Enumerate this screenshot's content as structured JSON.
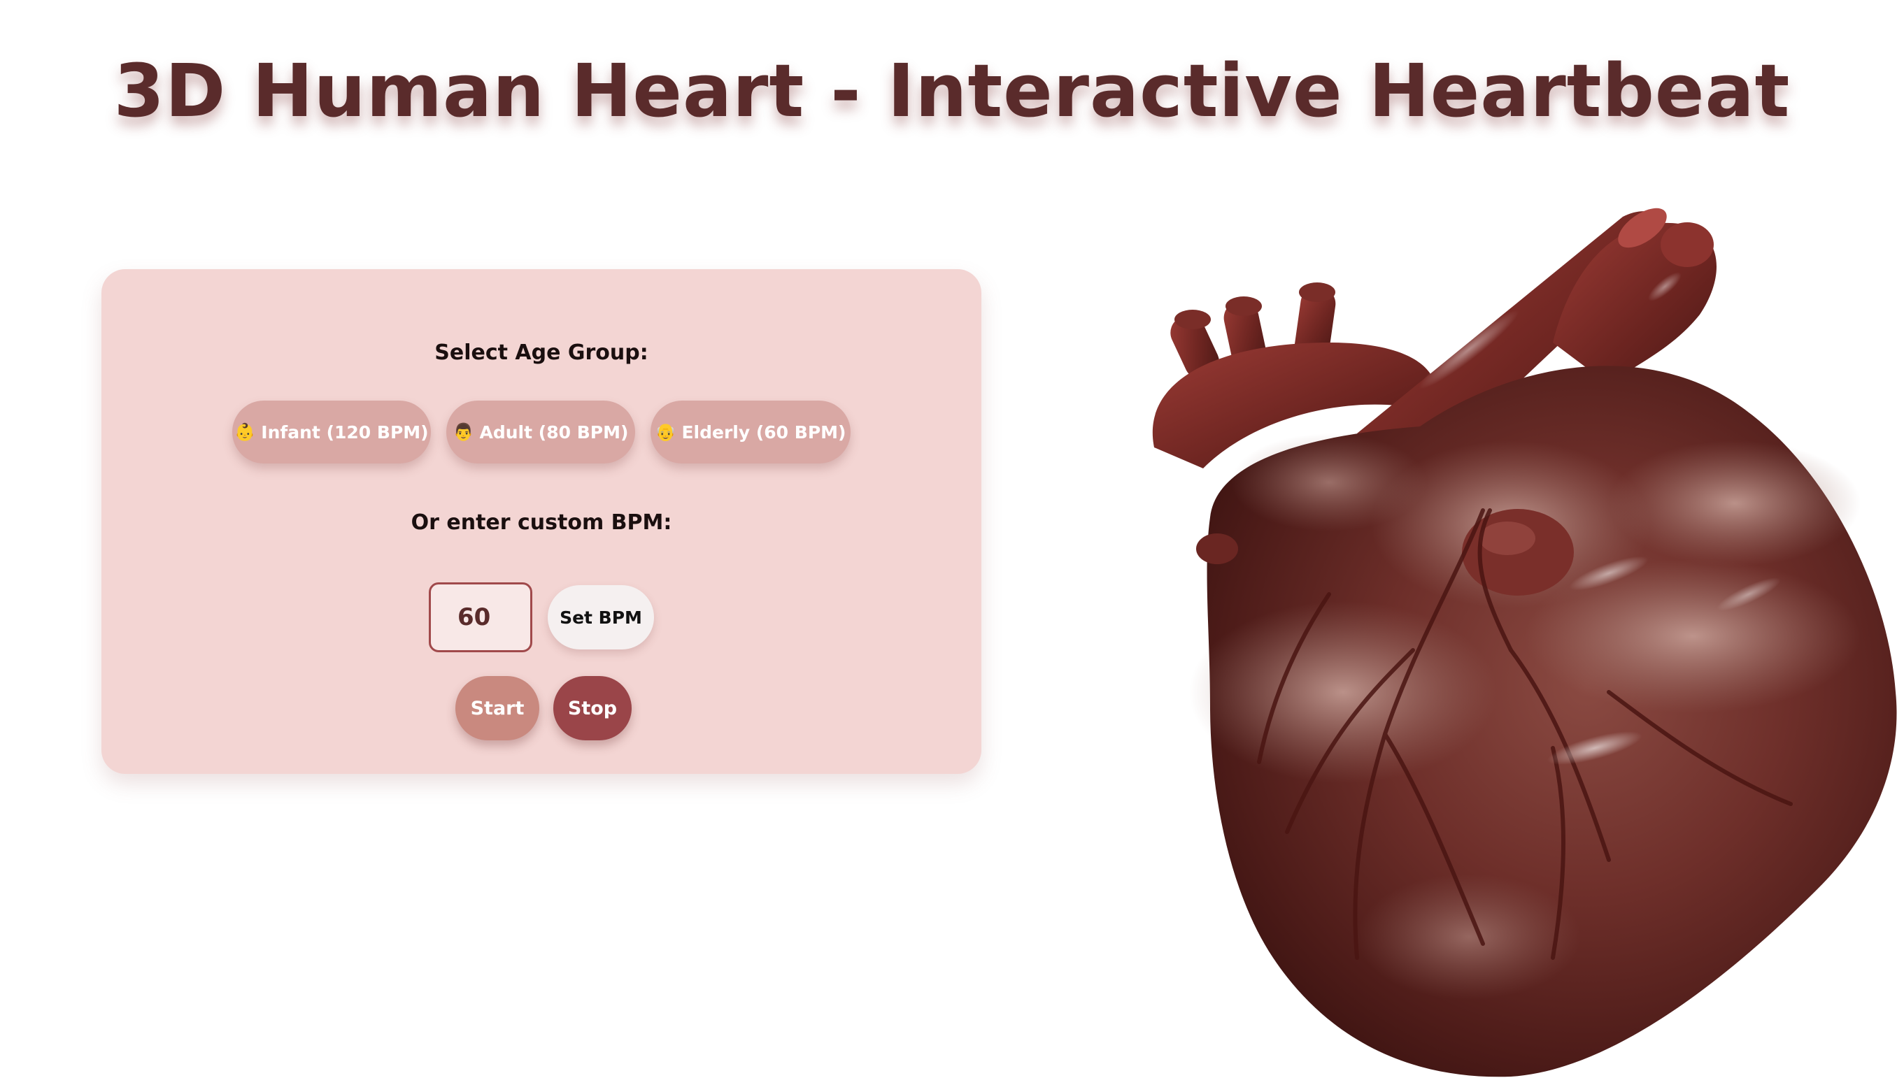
{
  "title": "3D Human Heart - Interactive Heartbeat",
  "controls": {
    "age_group_label": "Select Age Group:",
    "age_buttons": [
      {
        "emoji": "👶",
        "label": "Infant (120 BPM)"
      },
      {
        "emoji": "👨",
        "label": "Adult (80 BPM)"
      },
      {
        "emoji": "👴",
        "label": "Elderly (60 BPM)"
      }
    ],
    "custom_label": "Or enter custom BPM:",
    "bpm_input_value": "60",
    "set_bpm_label": "Set BPM",
    "start_label": "Start",
    "stop_label": "Stop"
  },
  "colors": {
    "title": "#5a2b2b",
    "panel_bg": "#f3d5d3",
    "age_button_bg": "#d9a8a4",
    "start_button_bg": "#c9897f",
    "stop_button_bg": "#9a4549",
    "input_border": "#a0494b",
    "heart_base": "#6e2a26"
  },
  "heart_model": {
    "icon": "anatomical-heart"
  }
}
